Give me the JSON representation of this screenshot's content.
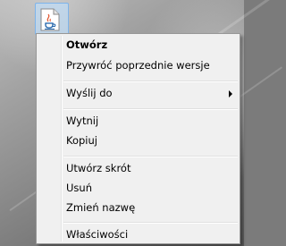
{
  "desktop": {
    "selected_file_icon": "java-file-icon"
  },
  "context_menu": {
    "items": [
      {
        "label": "Otwórz",
        "bold": true
      },
      {
        "label": "Przywróć poprzednie wersje"
      },
      {
        "label": "Wyślij do",
        "submenu_icon": "chevron-right-icon"
      },
      {
        "label": "Wytnij"
      },
      {
        "label": "Kopiuj"
      },
      {
        "label": "Utwórz skrót"
      },
      {
        "label": "Usuń"
      },
      {
        "label": "Zmień nazwę"
      },
      {
        "label": "Właściwości"
      }
    ]
  }
}
